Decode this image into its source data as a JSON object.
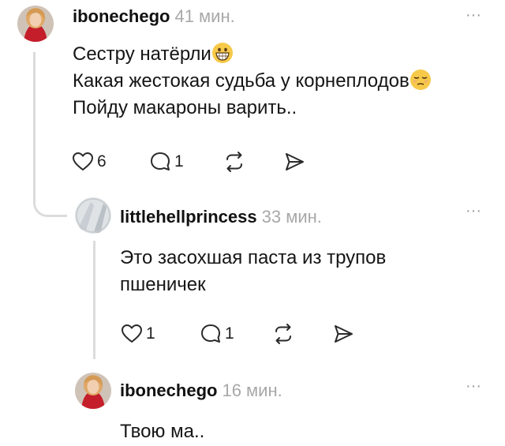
{
  "comments": [
    {
      "username": "ibonechego",
      "time": "41 мин.",
      "lines": [
        "Сестру натёрли",
        "Какая жестокая судьба у корнеплодов",
        "Пойду макароны варить.."
      ],
      "likes": "6",
      "replies": "1"
    },
    {
      "username": "littlehellprincess",
      "time": "33 мин.",
      "lines": [
        "Это засохшая паста из трупов",
        "пшеничек"
      ],
      "likes": "1",
      "replies": "1"
    },
    {
      "username": "ibonechego",
      "time": "16 мин.",
      "lines": [
        "Твою ма.."
      ]
    }
  ],
  "more_label": "···",
  "icons": {
    "like": "heart-icon",
    "reply": "comment-icon",
    "share": "repost-icon",
    "send": "send-icon",
    "grin": "grinning-emoji-icon",
    "sad": "pensive-emoji-icon"
  },
  "colors": {
    "time": "#a8a8a8",
    "thread_line": "#dcdcdc",
    "emoji": "#f6c949"
  }
}
